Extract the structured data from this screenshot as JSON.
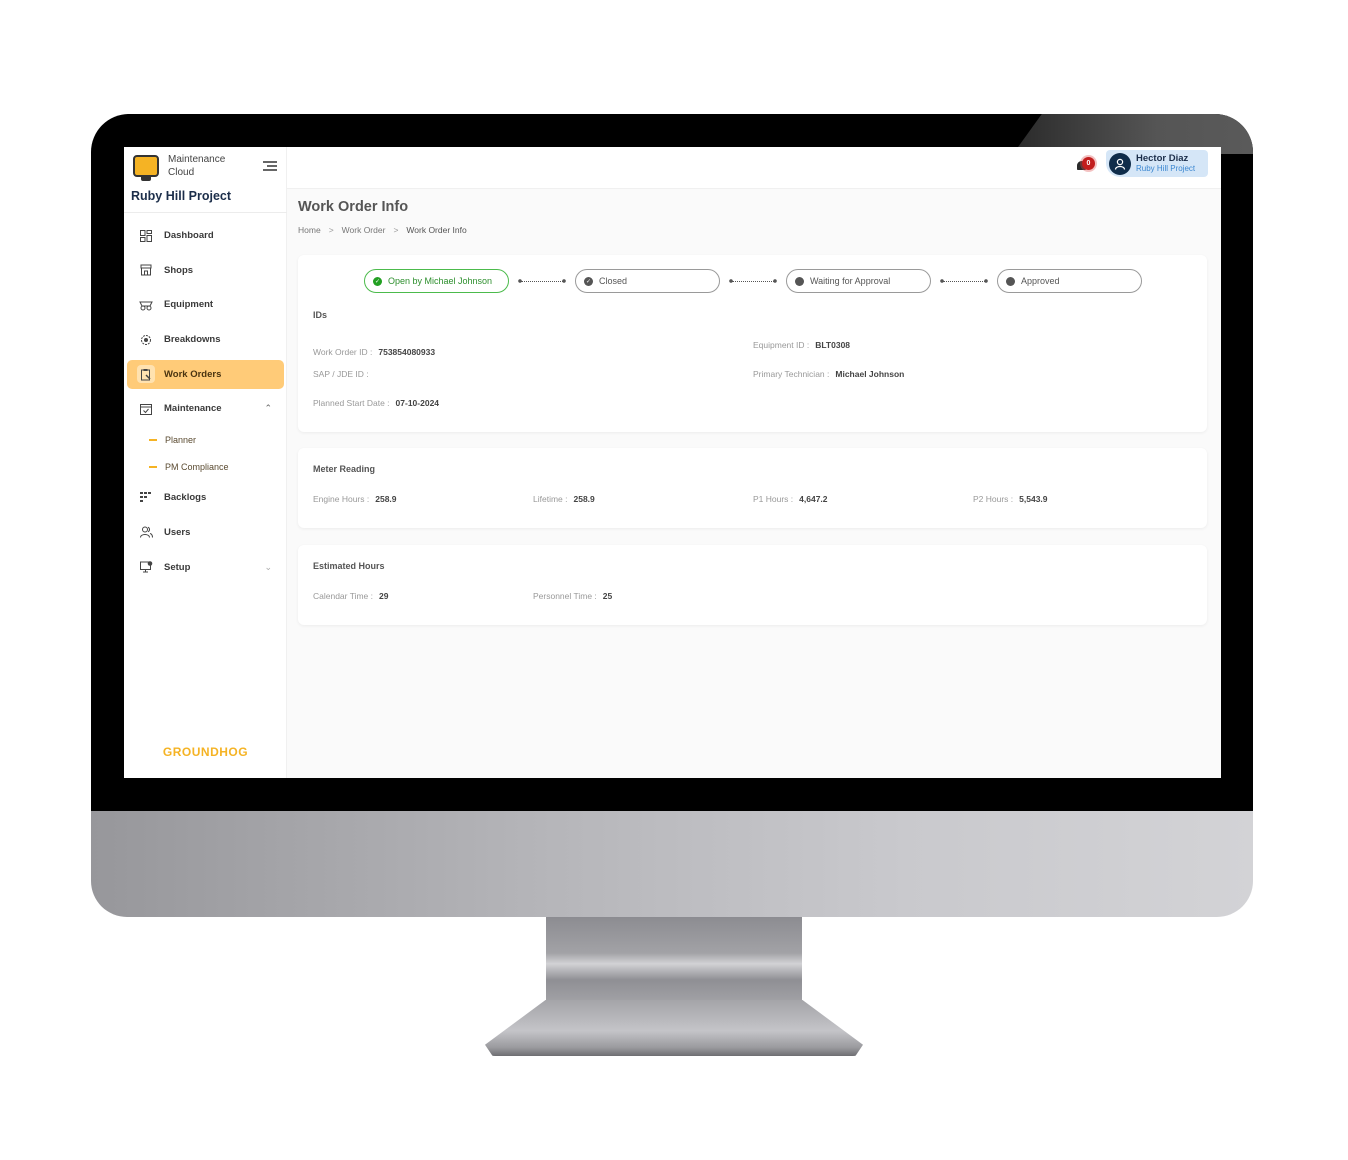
{
  "app": {
    "name_line1": "Maintenance",
    "name_line2": "Cloud",
    "project": "Ruby Hill Project",
    "footer_brand": "GROUNDHOG",
    "accent_color": "#ffcb78",
    "brand_color": "#f5b324"
  },
  "sidebar": {
    "items": [
      {
        "label": "Dashboard",
        "icon": "dashboard-grid-icon"
      },
      {
        "label": "Shops",
        "icon": "shop-icon"
      },
      {
        "label": "Equipment",
        "icon": "equipment-icon"
      },
      {
        "label": "Breakdowns",
        "icon": "breakdown-gear-icon"
      },
      {
        "label": "Work Orders",
        "icon": "clipboard-wrench-icon",
        "active": true
      },
      {
        "label": "Maintenance",
        "icon": "calendar-check-icon",
        "expanded": true,
        "children": [
          {
            "label": "Planner"
          },
          {
            "label": "PM Compliance"
          }
        ]
      },
      {
        "label": "Backlogs",
        "icon": "backlog-grid-icon"
      },
      {
        "label": "Users",
        "icon": "users-icon"
      },
      {
        "label": "Setup",
        "icon": "setup-monitor-icon",
        "expanded": false
      }
    ]
  },
  "topbar": {
    "notifications_count": "0",
    "user_name": "Hector Diaz",
    "user_project": "Ruby Hill Project"
  },
  "page": {
    "title": "Work Order Info",
    "breadcrumb": [
      "Home",
      "Work Order",
      "Work Order Info"
    ]
  },
  "status_steps": [
    {
      "label": "Open by Michael Johnson",
      "state": "done"
    },
    {
      "label": "Closed",
      "state": "pending"
    },
    {
      "label": "Waiting for Approval",
      "state": "pending"
    },
    {
      "label": "Approved",
      "state": "pending"
    }
  ],
  "ids": {
    "title": "IDs",
    "work_order_id_label": "Work Order ID :",
    "work_order_id": "753854080933",
    "sap_jde_label": "SAP / JDE ID :",
    "sap_jde": "",
    "planned_start_label": "Planned Start Date :",
    "planned_start": "07-10-2024",
    "equipment_id_label": "Equipment ID :",
    "equipment_id": "BLT0308",
    "primary_tech_label": "Primary Technician :",
    "primary_tech": "Michael Johnson"
  },
  "meter": {
    "title": "Meter Reading",
    "engine_hours_label": "Engine Hours :",
    "engine_hours": "258.9",
    "lifetime_label": "Lifetime :",
    "lifetime": "258.9",
    "p1_label": "P1 Hours :",
    "p1": "4,647.2",
    "p2_label": "P2 Hours :",
    "p2": "5,543.9"
  },
  "estimated": {
    "title": "Estimated Hours",
    "calendar_label": "Calendar Time :",
    "calendar": "29",
    "personnel_label": "Personnel Time :",
    "personnel": "25"
  }
}
